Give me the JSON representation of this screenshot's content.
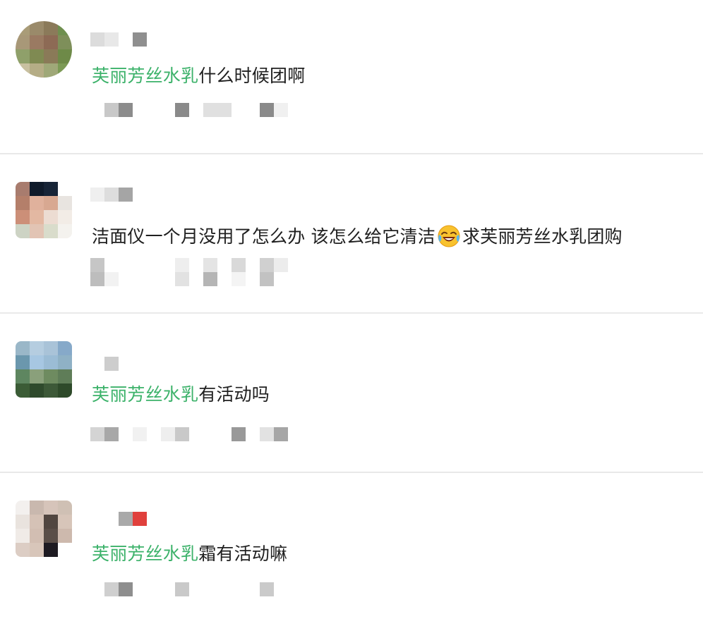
{
  "comments": [
    {
      "highlight": "芙丽芳丝水乳",
      "text": "什么时候团啊"
    },
    {
      "part1": "洁面仪一个月没用了怎么办  该怎么给它清洁",
      "emoji": "crying-laughing-emoji",
      "part2": "求芙丽芳丝水乳团购"
    },
    {
      "highlight": "芙丽芳丝水乳",
      "text": "有活动吗"
    },
    {
      "highlight": "芙丽芳丝水乳",
      "text": "霜有活动嘛"
    }
  ],
  "colors": {
    "highlight": "#3cb26a",
    "text": "#1f1f1f",
    "divider": "#e9e9e9"
  }
}
